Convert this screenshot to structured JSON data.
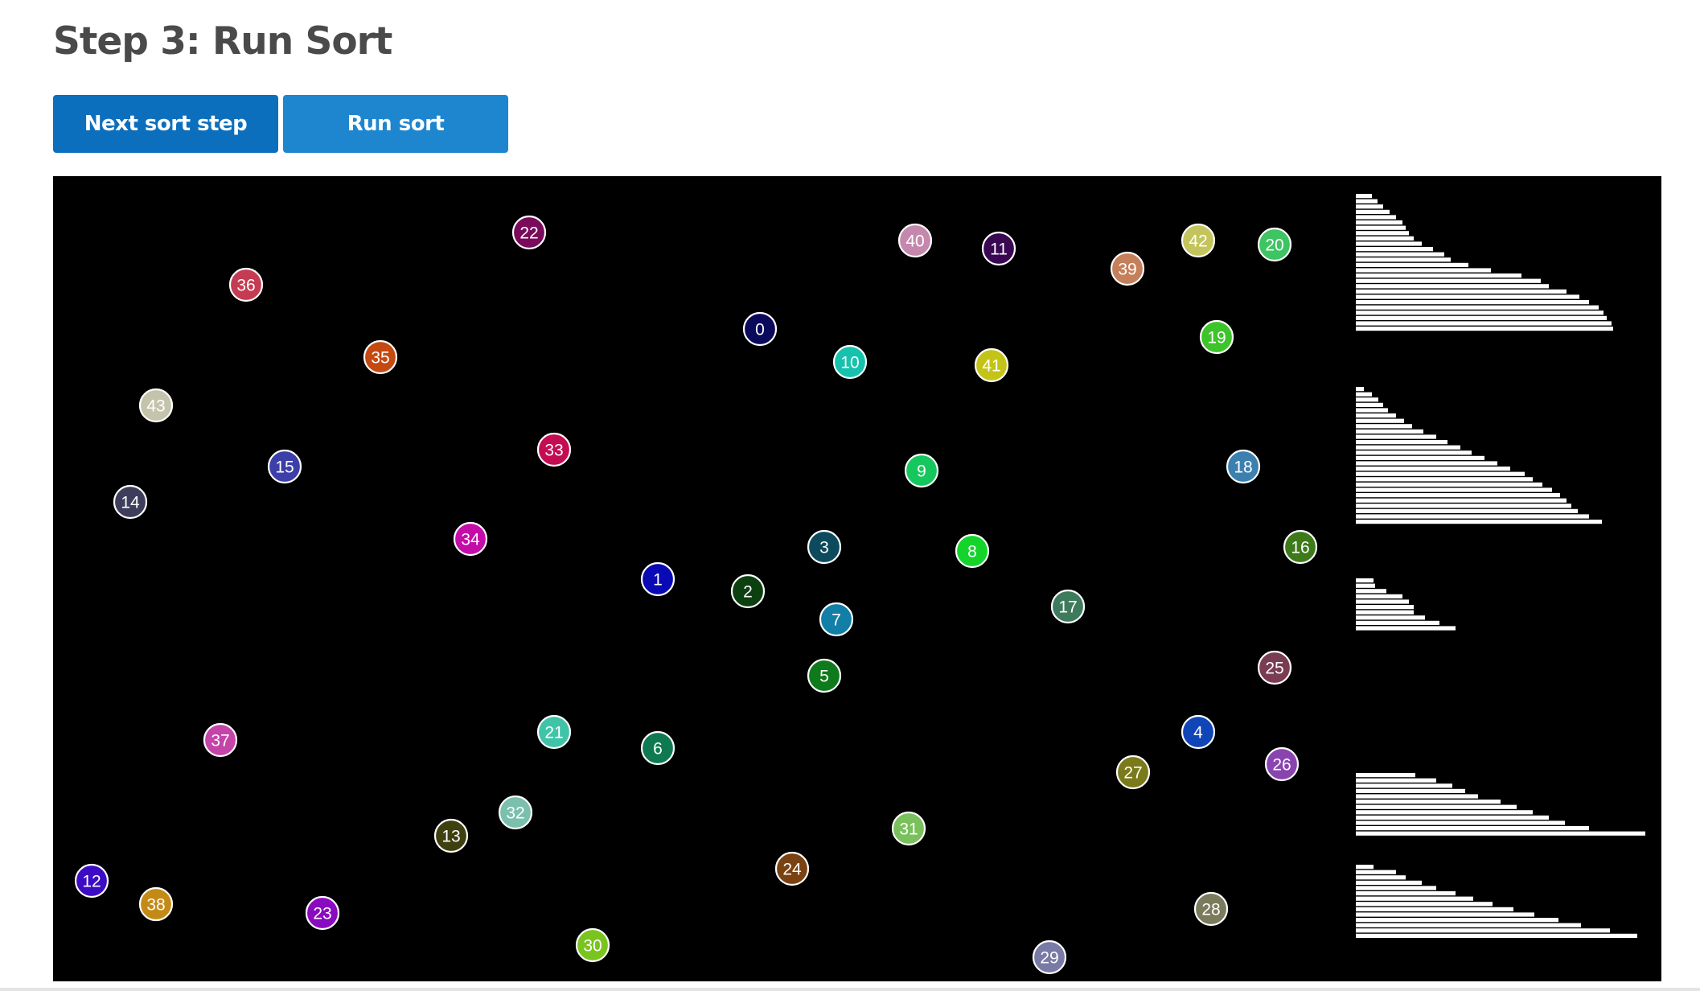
{
  "heading": "Step 3: Run Sort",
  "buttons": {
    "next_step": "Next sort step",
    "run_sort": "Run sort"
  },
  "nodes": [
    {
      "label": "0",
      "color": "#0a0a5c"
    },
    {
      "label": "1",
      "color": "#0a0ab4"
    },
    {
      "label": "2",
      "color": "#0c4010"
    },
    {
      "label": "3",
      "color": "#0e4a5e"
    },
    {
      "label": "4",
      "color": "#1045b8"
    },
    {
      "label": "5",
      "color": "#0e7a1c"
    },
    {
      "label": "6",
      "color": "#0f7a52"
    },
    {
      "label": "7",
      "color": "#127fa6"
    },
    {
      "label": "8",
      "color": "#14d42c"
    },
    {
      "label": "9",
      "color": "#16c75e"
    },
    {
      "label": "10",
      "color": "#16c2ad"
    },
    {
      "label": "11",
      "color": "#3a0852"
    },
    {
      "label": "12",
      "color": "#3c0cc4"
    },
    {
      "label": "13",
      "color": "#3f4010"
    },
    {
      "label": "14",
      "color": "#3e3e5c"
    },
    {
      "label": "15",
      "color": "#3d3fa8"
    },
    {
      "label": "16",
      "color": "#3d7a1a"
    },
    {
      "label": "17",
      "color": "#3e7a5c"
    },
    {
      "label": "18",
      "color": "#3c80b0"
    },
    {
      "label": "19",
      "color": "#3dc42a"
    },
    {
      "label": "20",
      "color": "#3ec462"
    },
    {
      "label": "21",
      "color": "#40c4a8"
    },
    {
      "label": "22",
      "color": "#7a0a5a"
    },
    {
      "label": "23",
      "color": "#8a0ac0"
    },
    {
      "label": "24",
      "color": "#7a4212"
    },
    {
      "label": "25",
      "color": "#7a3c52"
    },
    {
      "label": "26",
      "color": "#8a44b0"
    },
    {
      "label": "27",
      "color": "#7a7a1a"
    },
    {
      "label": "28",
      "color": "#7a7a5c"
    },
    {
      "label": "29",
      "color": "#7a7aa6"
    },
    {
      "label": "30",
      "color": "#7ac420"
    },
    {
      "label": "31",
      "color": "#7ac05c"
    },
    {
      "label": "32",
      "color": "#7ac0ac"
    },
    {
      "label": "33",
      "color": "#c40c52"
    },
    {
      "label": "34",
      "color": "#c40ca8"
    },
    {
      "label": "35",
      "color": "#c44a12"
    },
    {
      "label": "36",
      "color": "#c43c52"
    },
    {
      "label": "37",
      "color": "#c444a8"
    },
    {
      "label": "38",
      "color": "#c48a16"
    },
    {
      "label": "39",
      "color": "#c4805a"
    },
    {
      "label": "40",
      "color": "#c488ac"
    },
    {
      "label": "41",
      "color": "#c4c418"
    },
    {
      "label": "42",
      "color": "#c4c45c"
    },
    {
      "label": "43",
      "color": "#c4c4ac"
    }
  ]
}
